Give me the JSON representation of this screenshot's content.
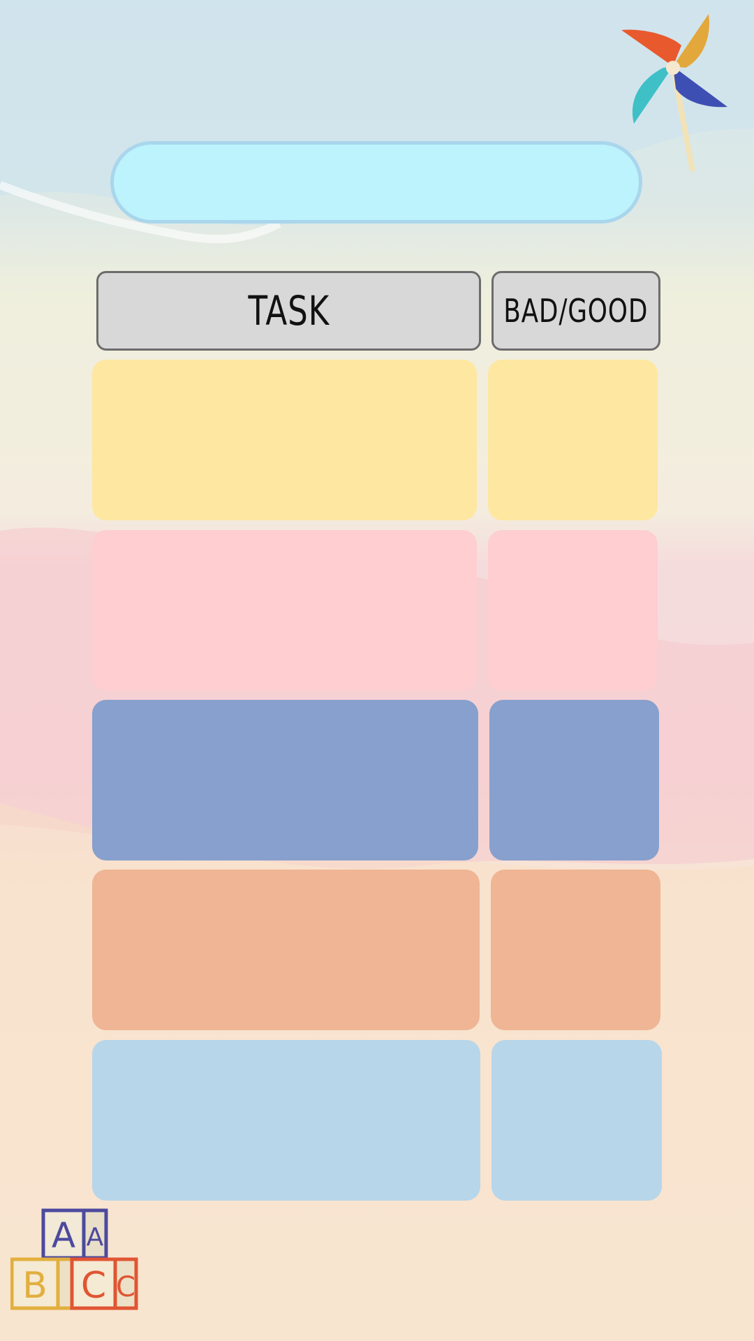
{
  "header": {
    "task_label": "TASK",
    "score_label": "BAD/GOOD"
  },
  "rows": [
    {
      "color": "#FEE7A0"
    },
    {
      "color": "#FECED1"
    },
    {
      "color": "#87A0CD"
    },
    {
      "color": "#EFB595"
    },
    {
      "color": "#B7D6EA"
    }
  ],
  "decor": {
    "pinwheel_icon": "pinwheel-icon",
    "blocks_icon": "alphabet-blocks-icon",
    "block_letters": [
      "A",
      "A",
      "B",
      "C",
      "C"
    ]
  }
}
